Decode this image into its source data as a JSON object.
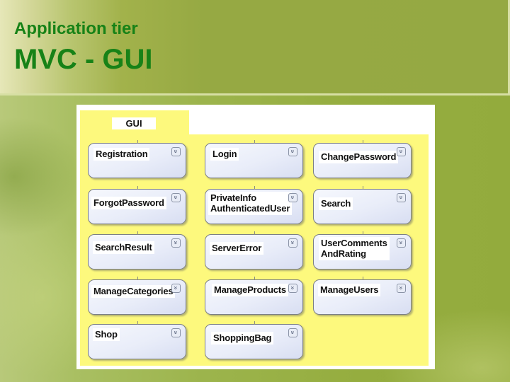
{
  "slide": {
    "subtitle": "Application tier",
    "title": "MVC - GUI"
  },
  "diagram": {
    "package_name": "GUI",
    "expander_glyph": "»",
    "components": [
      {
        "name": "Registration",
        "lines": [
          "Registration"
        ]
      },
      {
        "name": "Login",
        "lines": [
          "Login"
        ]
      },
      {
        "name": "ChangePassword",
        "lines": [
          "ChangePassword"
        ]
      },
      {
        "name": "ForgotPassword",
        "lines": [
          "ForgotPassword"
        ]
      },
      {
        "name": "PrivateInfo AuthenticatedUser",
        "lines": [
          "PrivateInfo",
          "AuthenticatedUser"
        ]
      },
      {
        "name": "Search",
        "lines": [
          "Search"
        ]
      },
      {
        "name": "SearchResult",
        "lines": [
          "SearchResult"
        ]
      },
      {
        "name": "ServerError",
        "lines": [
          "ServerError"
        ]
      },
      {
        "name": "UserComments AndRating",
        "lines": [
          "UserComments",
          "AndRating"
        ]
      },
      {
        "name": "ManageCategories",
        "lines": [
          "ManageCategories"
        ]
      },
      {
        "name": "ManageProducts",
        "lines": [
          "ManageProducts"
        ]
      },
      {
        "name": "ManageUsers",
        "lines": [
          "ManageUsers"
        ]
      },
      {
        "name": "Shop",
        "lines": [
          "Shop"
        ]
      },
      {
        "name": "ShoppingBag",
        "lines": [
          "ShoppingBag"
        ]
      }
    ]
  },
  "colors": {
    "title_green": "#178217",
    "diagram_yellow": "#fdf97d",
    "box_fill": "#e9edf9"
  }
}
